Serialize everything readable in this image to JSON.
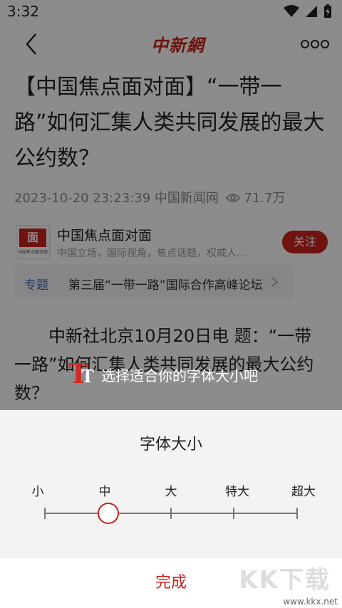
{
  "status_bar": {
    "time": "3:32"
  },
  "nav": {
    "logo": "中新網"
  },
  "article": {
    "title": "【中国焦点面对面】“一带一路”如何汇集人类共同发展的最大公约数？",
    "datetime": "2023-10-20 23:23:39",
    "source": "中国新闻网",
    "views": "71.7万",
    "body": "　　中新社北京10月20日电 题：“一带一路”如何汇集人类共同发展的最大公约数？"
  },
  "account": {
    "name": "中国焦点面对面",
    "desc": "中国立场，国际视角，焦点话题，权威人...",
    "avatar_text": "面",
    "follow_label": "关注"
  },
  "topic": {
    "tag": "专题",
    "text": "第三届“一带一路”国际合作高峰论坛"
  },
  "hint": {
    "text": "选择适合你的字体大小吧"
  },
  "font_sheet": {
    "title": "字体大小",
    "levels": [
      "小",
      "中",
      "大",
      "特大",
      "超大"
    ],
    "selected": "中",
    "done_label": "完成"
  },
  "watermark": {
    "brand": "KK下载",
    "url": "www.kkx.net"
  },
  "colors": {
    "accent": "#c8231c",
    "topic_tag": "#3f6fb3"
  }
}
